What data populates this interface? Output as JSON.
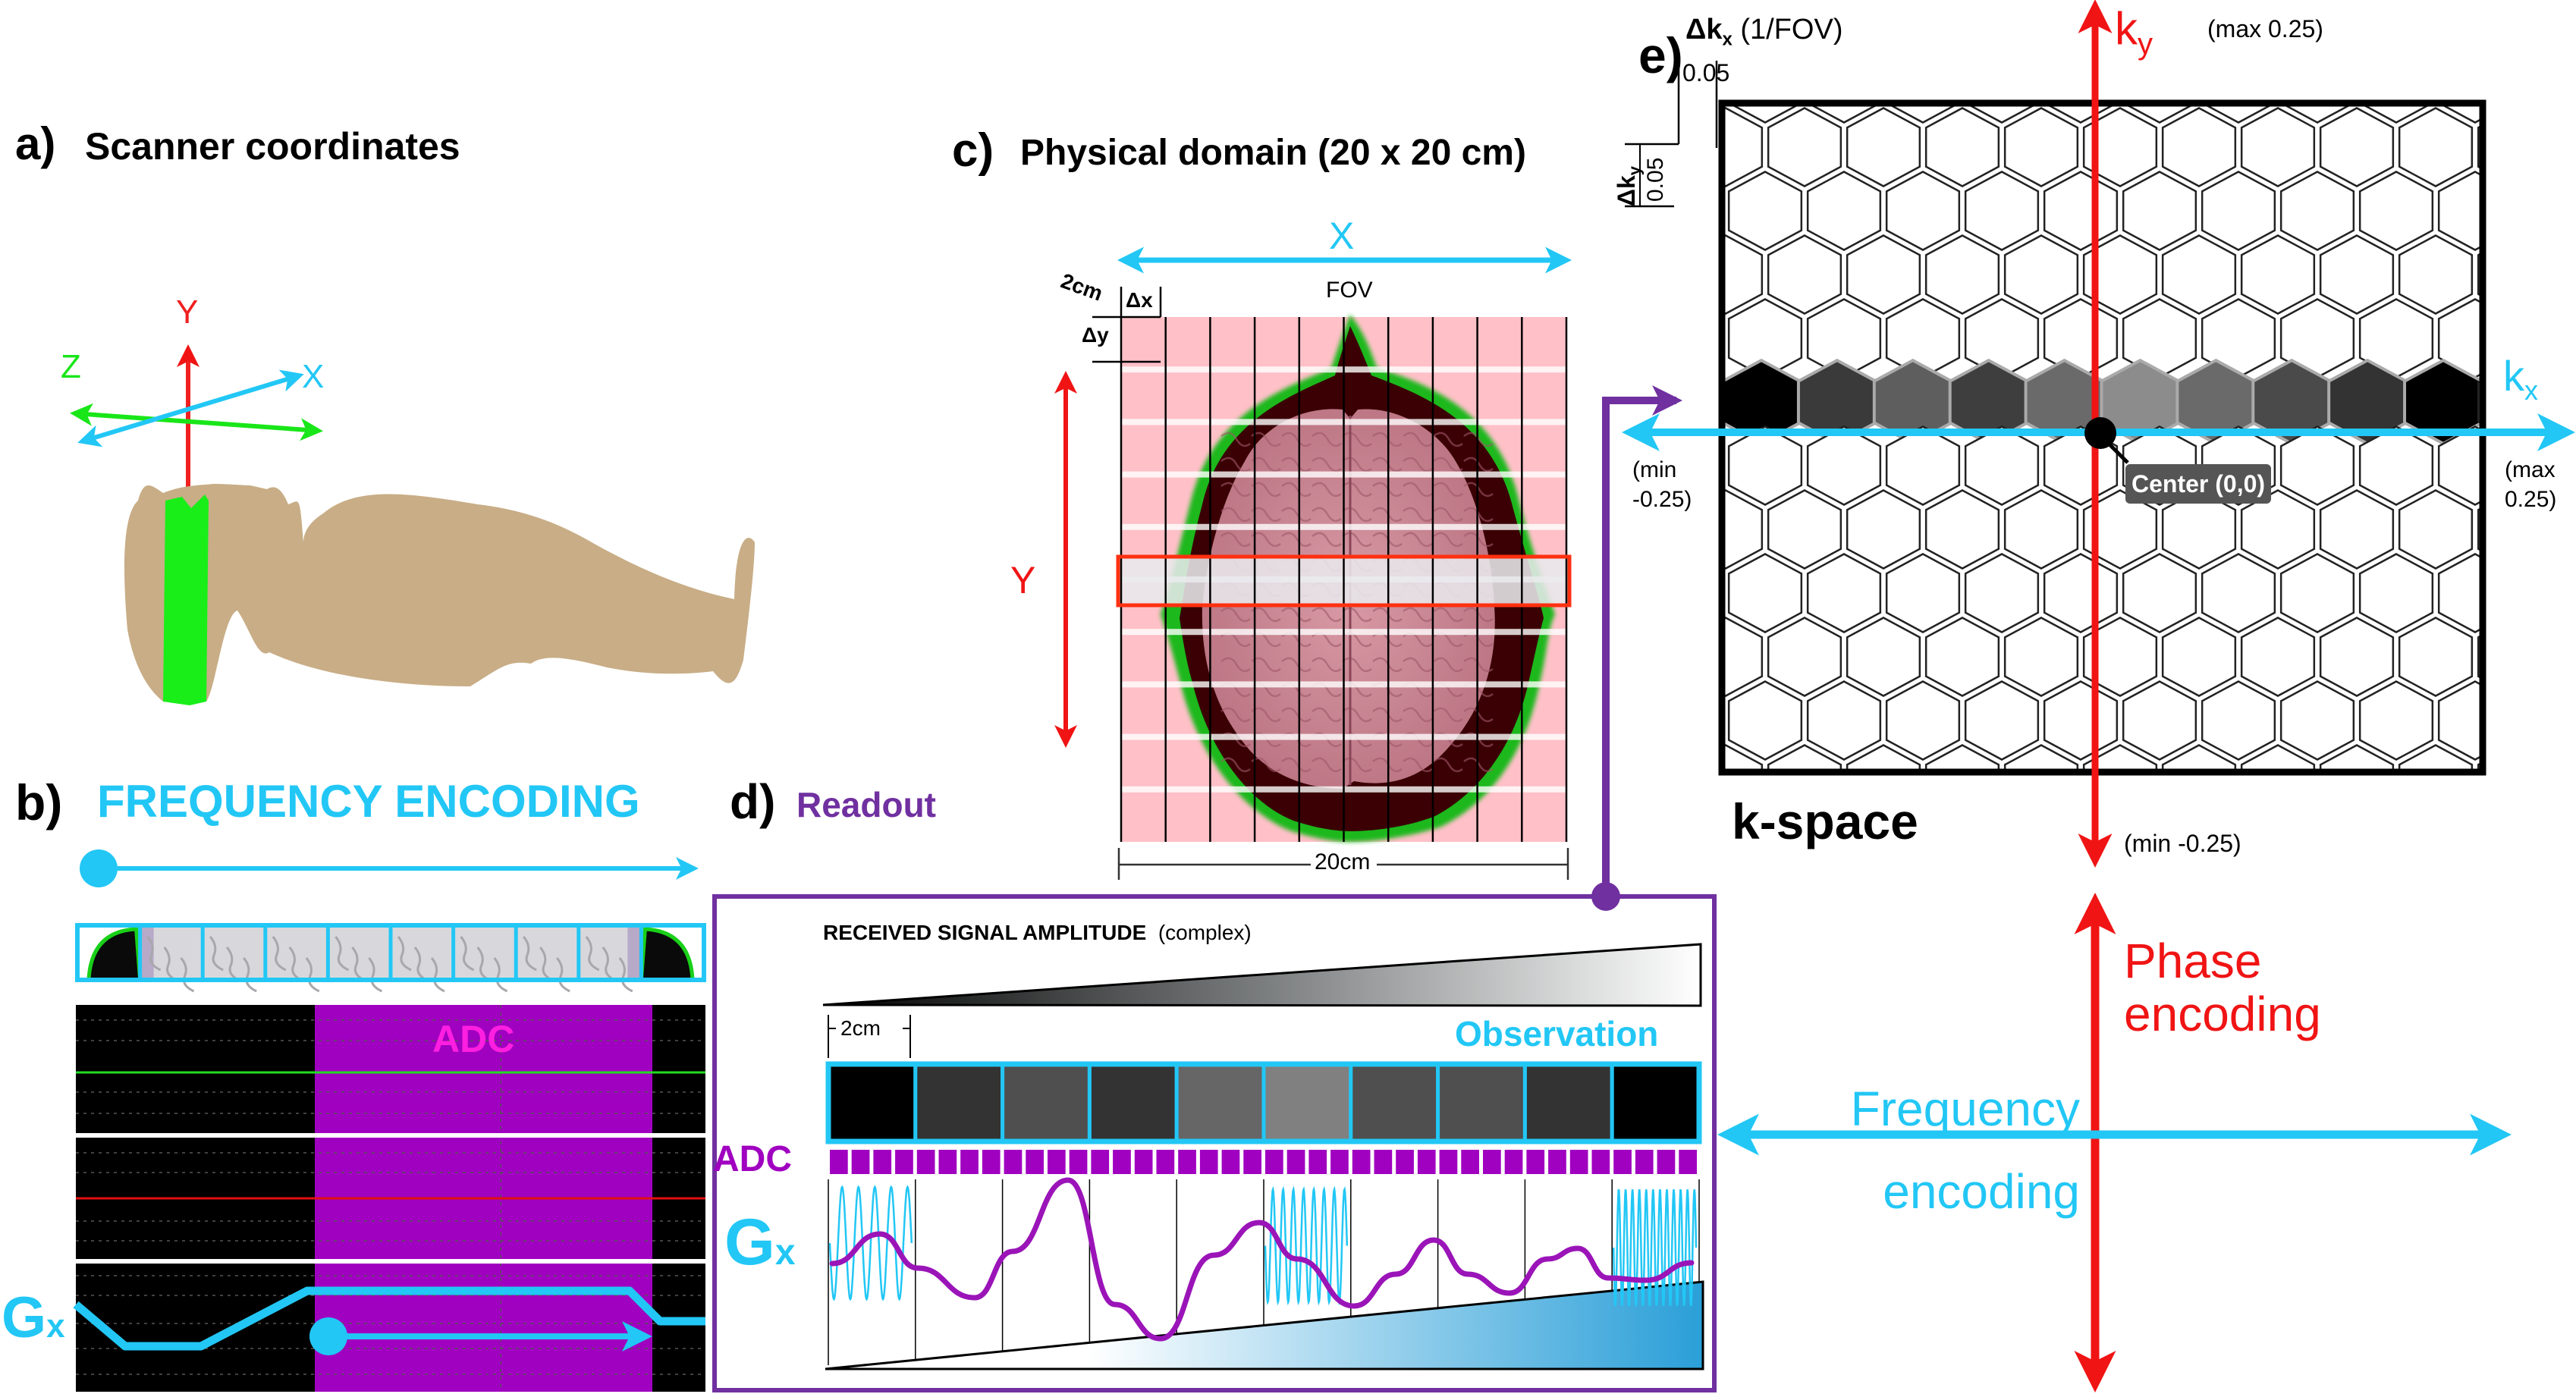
{
  "colors": {
    "cyan": "#22c7f5",
    "red": "#f01414",
    "green": "#19e619",
    "purple": "#7030a0",
    "adc_purple": "#a000c0",
    "adc_label": "#ff1fe0",
    "skin": "#c8ad86",
    "grid_pink": "#ffc0c8"
  },
  "panel_a": {
    "letter": "a)",
    "title": "Scanner coordinates",
    "axes": [
      {
        "name": "Y",
        "color": "#f02020"
      },
      {
        "name": "Z",
        "color": "#19e619"
      },
      {
        "name": "X",
        "color": "#22c7f5"
      }
    ]
  },
  "panel_b": {
    "letter": "b)",
    "title": "FREQUENCY ENCODING",
    "adc_label": "ADC",
    "gradient_label_main": "G",
    "gradient_label_sub": "x",
    "strip_cells": 10
  },
  "panel_c": {
    "letter": "c)",
    "title": "Physical domain (20 x 20 cm)",
    "x_axis_label": "X",
    "y_axis_label": "Y",
    "fov_label": "FOV",
    "cell_size_label": "2cm",
    "dx_label": "Δx",
    "dy_label": "Δy",
    "width_label": "20cm",
    "grid_cells": 10
  },
  "panel_d": {
    "letter": "d)",
    "title": "Readout",
    "amplitude_label": "RECEIVED SIGNAL AMPLITUDE",
    "amplitude_note": "(complex)",
    "cell_size_label": "2cm",
    "observation_label": "Observation",
    "observation_gray_levels": [
      "#000000",
      "#333333",
      "#4f4f4f",
      "#333333",
      "#666666",
      "#808080",
      "#4f4f4f",
      "#4f4f4f",
      "#333333",
      "#000000"
    ],
    "adc_label": "ADC",
    "adc_samples": 40,
    "gradient_label_main": "G",
    "gradient_label_sub": "x"
  },
  "panel_e": {
    "letter": "e)",
    "dkx_label_main": "Δk",
    "dkx_label_sub": "x",
    "dkx_note": "(1/FOV)",
    "dkx_value": "0.05",
    "dky_label_main": "Δk",
    "dky_label_sub": "y",
    "dky_value": "0.05",
    "ky_label_main": "k",
    "ky_label_sub": "y",
    "ky_max": "(max 0.25)",
    "ky_min": "(min -0.25)",
    "kx_label_main": "k",
    "kx_label_sub": "x",
    "kx_min_line1": "(min",
    "kx_min_line2": "-0.25)",
    "kx_max_line1": "(max",
    "kx_max_line2": "0.25)",
    "center_label": "Center (0,0)",
    "kspace_label": "k-space",
    "highlight_row_gray_levels": [
      "#000000",
      "#3a3a3a",
      "#5e5e5e",
      "#3e3e3e",
      "#6a6a6a",
      "#8c8c8c",
      "#6a6a6a",
      "#4a4a4a",
      "#333333",
      "#000000"
    ]
  },
  "legend": {
    "phase_line1": "Phase",
    "phase_line2": "encoding",
    "freq_line1": "Frequency",
    "freq_line2": "encoding"
  }
}
